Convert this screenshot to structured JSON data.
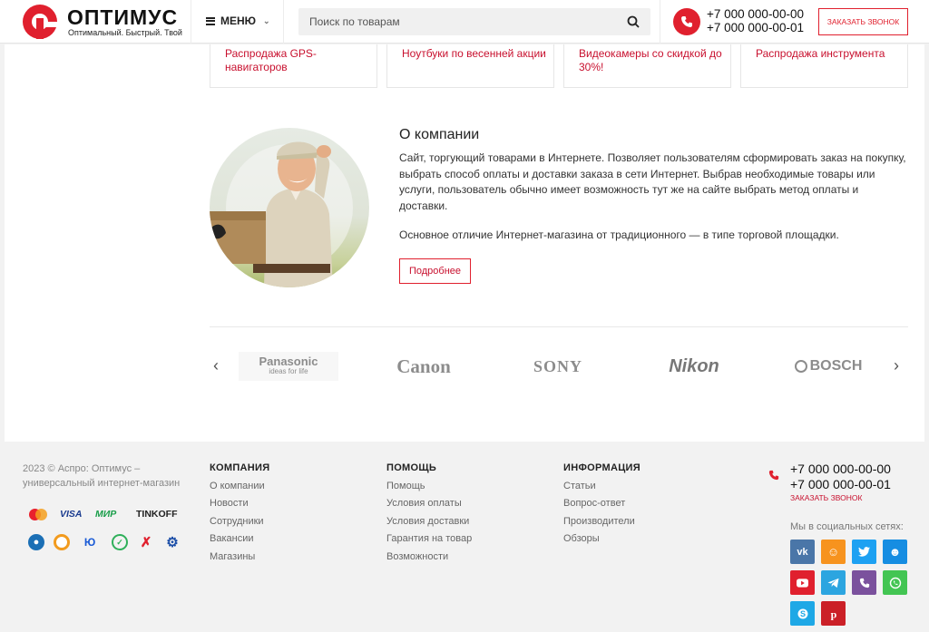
{
  "header": {
    "logo_name": "ОПТИМУС",
    "logo_slogan": "Оптимальный. Быстрый. Твой",
    "menu_label": "МЕНЮ",
    "search_placeholder": "Поиск по товарам",
    "phone1": "+7 000 000-00-00",
    "phone2": "+7 000 000-00-01",
    "call_button": "ЗАКАЗАТЬ ЗВОНОК"
  },
  "promos": [
    {
      "text": "Распродажа GPS-навигаторов"
    },
    {
      "text": "Ноутбуки по весенней акции"
    },
    {
      "text": "Видеокамеры со скидкой до 30%!"
    },
    {
      "text": "Распродажа инструмента"
    }
  ],
  "about": {
    "title": "О компании",
    "paragraph1": "Сайт, торгующий товарами в Интернете. Позволяет пользователям сформировать заказ на покупку, выбрать способ оплаты и доставки заказа в сети Интернет. Выбрав необходимые товары или услуги, пользователь обычно имеет возможность тут же на сайте выбрать метод оплаты и доставки.",
    "paragraph2": "Основное отличие Интернет-магазина от традиционного — в типе торговой площадки.",
    "more_button": "Подробнее"
  },
  "brands": [
    {
      "name": "Panasonic",
      "sub": "ideas for life"
    },
    {
      "name": "Canon"
    },
    {
      "name": "SONY"
    },
    {
      "name": "Nikon"
    },
    {
      "name": "BOSCH"
    }
  ],
  "footer": {
    "copyright": "2023 © Аспро: Оптимус – универсальный интернет-магазин",
    "payments_row1": [
      "VISA",
      "МИР",
      "TINKOFF"
    ],
    "columns": [
      {
        "title": "КОМПАНИЯ",
        "links": [
          "О компании",
          "Новости",
          "Сотрудники",
          "Вакансии",
          "Магазины"
        ]
      },
      {
        "title": "ПОМОЩЬ",
        "links": [
          "Помощь",
          "Условия оплаты",
          "Условия доставки",
          "Гарантия на товар",
          "Возможности"
        ]
      },
      {
        "title": "ИНФОРМАЦИЯ",
        "links": [
          "Статьи",
          "Вопрос-ответ",
          "Производители",
          "Обзоры"
        ]
      }
    ],
    "phone1": "+7 000 000-00-00",
    "phone2": "+7 000 000-00-01",
    "call_link": "ЗАКАЗАТЬ ЗВОНОК",
    "social_title": "Мы в социальных сетях:"
  },
  "colors": {
    "accent": "#e0202e",
    "link": "#c8102e"
  },
  "social_icons": [
    "vk-icon",
    "odnoklassniki-icon",
    "twitter-icon",
    "moi-mir-icon",
    "youtube-icon",
    "telegram-icon",
    "viber-icon",
    "whatsapp-icon",
    "skype-icon",
    "pinterest-icon"
  ]
}
